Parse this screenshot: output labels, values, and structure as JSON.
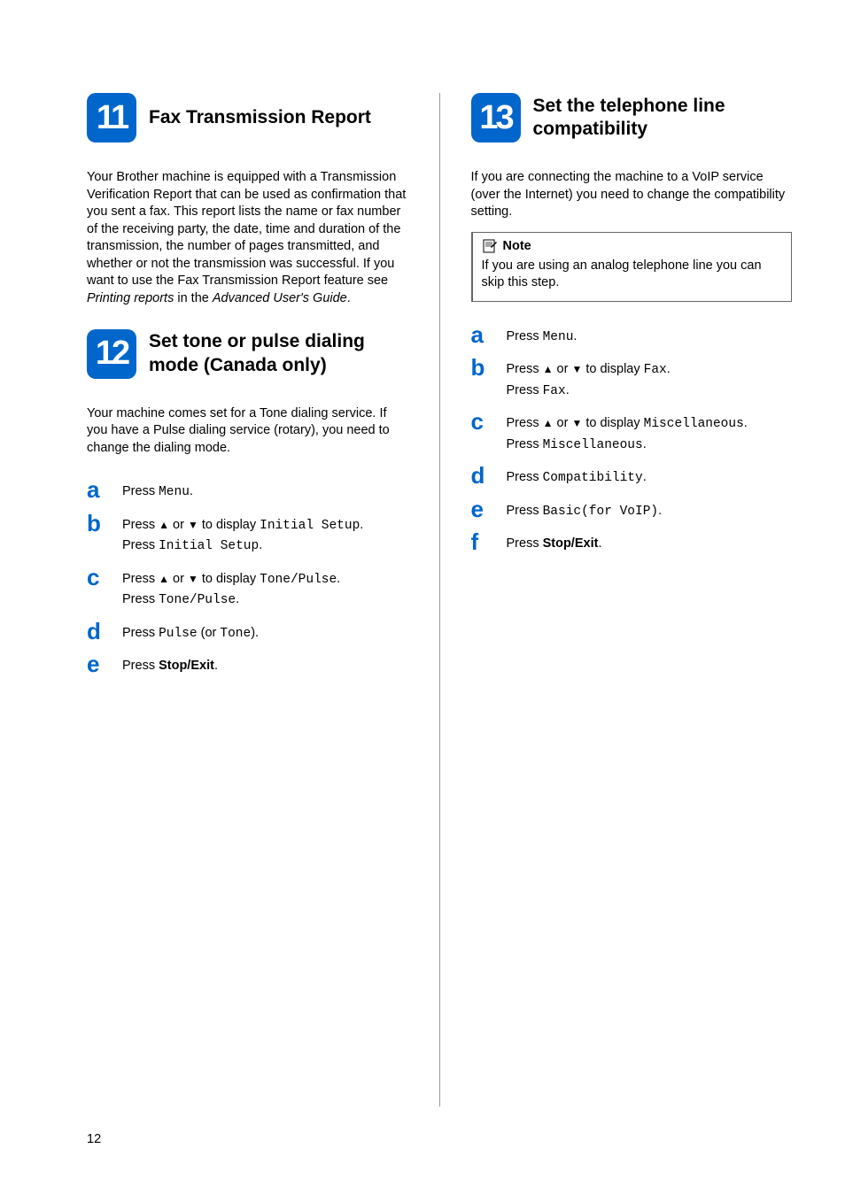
{
  "pageNumber": "12",
  "leftColumn": {
    "section11": {
      "number": "11",
      "title": "Fax Transmission Report",
      "body_p1": "Your Brother machine is equipped with a Transmission Verification Report that can be used as confirmation that you sent a fax. This report lists the name or fax number of the receiving party, the date, time and duration of the transmission, the number of pages transmitted, and whether or not the transmission was successful. If you want to use the Fax Transmission Report feature see ",
      "body_italic1": "Printing reports",
      "body_p2": " in the ",
      "body_italic2": "Advanced User's Guide",
      "body_p3": "."
    },
    "section12": {
      "number": "12",
      "title": "Set tone or pulse dialing mode (Canada only)",
      "body": "Your machine comes set for a Tone dialing service. If you have a Pulse dialing service (rotary), you need to change the dialing mode.",
      "steps": {
        "a": {
          "letter": "a",
          "pre": "Press ",
          "mono": "Menu",
          "post": "."
        },
        "b": {
          "letter": "b",
          "line1_pre": "Press ",
          "line1_up": "▲",
          "line1_mid": " or ",
          "line1_down": "▼",
          "line1_todisplay": " to display ",
          "line1_mono": "Initial Setup",
          "line1_post": ".",
          "line2_pre": "Press ",
          "line2_mono": "Initial Setup",
          "line2_post": "."
        },
        "c": {
          "letter": "c",
          "line1_pre": "Press ",
          "line1_up": "▲",
          "line1_mid": " or ",
          "line1_down": "▼",
          "line1_todisplay": " to display ",
          "line1_mono": "Tone/Pulse",
          "line1_post": ".",
          "line2_pre": "Press ",
          "line2_mono": "Tone/Pulse",
          "line2_post": "."
        },
        "d": {
          "letter": "d",
          "pre": "Press ",
          "mono1": "Pulse",
          "mid": " (or ",
          "mono2": "Tone",
          "post": ")."
        },
        "e": {
          "letter": "e",
          "pre": "Press ",
          "bold": "Stop/Exit",
          "post": "."
        }
      }
    }
  },
  "rightColumn": {
    "section13": {
      "number": "13",
      "title": "Set the telephone line compatibility",
      "body": "If you are connecting the machine to a VoIP service (over the Internet) you need to change the compatibility setting.",
      "note": {
        "label": "Note",
        "text": "If you are using an analog telephone line you can skip this step."
      },
      "steps": {
        "a": {
          "letter": "a",
          "pre": "Press ",
          "mono": "Menu",
          "post": "."
        },
        "b": {
          "letter": "b",
          "line1_pre": "Press ",
          "line1_up": "▲",
          "line1_mid": " or ",
          "line1_down": "▼",
          "line1_todisplay": " to display ",
          "line1_mono": "Fax",
          "line1_post": ".",
          "line2_pre": "Press ",
          "line2_mono": "Fax",
          "line2_post": "."
        },
        "c": {
          "letter": "c",
          "line1_pre": "Press ",
          "line1_up": "▲",
          "line1_mid": " or ",
          "line1_down": "▼",
          "line1_todisplay": " to display ",
          "line1_mono": "Miscellaneous",
          "line1_post": ".",
          "line2_pre": "Press ",
          "line2_mono": "Miscellaneous",
          "line2_post": "."
        },
        "d": {
          "letter": "d",
          "pre": "Press ",
          "mono": "Compatibility",
          "post": "."
        },
        "e": {
          "letter": "e",
          "pre": "Press ",
          "mono": "Basic(for VoIP)",
          "post": "."
        },
        "f": {
          "letter": "f",
          "pre": "Press ",
          "bold": "Stop/Exit",
          "post": "."
        }
      }
    }
  }
}
